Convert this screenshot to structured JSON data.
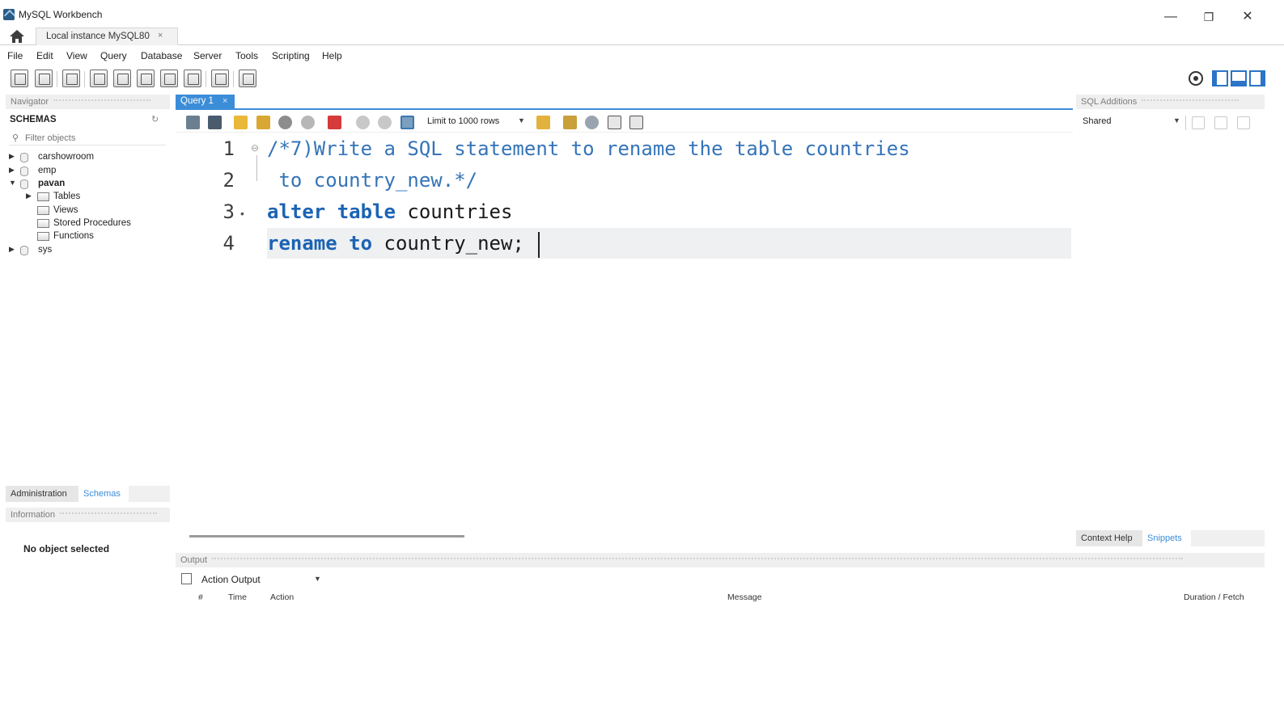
{
  "window": {
    "title": "MySQL Workbench",
    "minimize_glyph": "—",
    "restore_glyph": "❐",
    "close_glyph": "✕"
  },
  "connection_tab": {
    "label": "Local instance MySQL80",
    "close": "×"
  },
  "menu": [
    "File",
    "Edit",
    "View",
    "Query",
    "Database",
    "Server",
    "Tools",
    "Scripting",
    "Help"
  ],
  "navigator": {
    "header": "Navigator",
    "schemas_label": "SCHEMAS",
    "filter_placeholder": "Filter objects",
    "tree": [
      {
        "label": "carshowroom",
        "level": 0,
        "expanded": false,
        "type": "schema",
        "bold": false
      },
      {
        "label": "emp",
        "level": 0,
        "expanded": false,
        "type": "schema",
        "bold": false
      },
      {
        "label": "pavan",
        "level": 0,
        "expanded": true,
        "type": "schema",
        "bold": true
      },
      {
        "label": "Tables",
        "level": 1,
        "expanded": false,
        "type": "folder",
        "bold": false
      },
      {
        "label": "Views",
        "level": 1,
        "expanded": null,
        "type": "folder",
        "bold": false
      },
      {
        "label": "Stored Procedures",
        "level": 1,
        "expanded": null,
        "type": "folder",
        "bold": false
      },
      {
        "label": "Functions",
        "level": 1,
        "expanded": null,
        "type": "folder",
        "bold": false
      },
      {
        "label": "sys",
        "level": 0,
        "expanded": false,
        "type": "schema",
        "bold": false
      }
    ],
    "bottom_tabs": [
      "Administration",
      "Schemas"
    ],
    "active_bottom_tab": "Schemas",
    "info_header": "Information",
    "no_object": "No object selected"
  },
  "query_tab": {
    "label": "Query 1",
    "close": "×"
  },
  "sql_toolbar": {
    "limit_label": "Limit to 1000 rows"
  },
  "editor": {
    "lines": [
      {
        "num": "1",
        "marker": "",
        "segments": [
          {
            "text": "/*7)Write a SQL statement to rename the table countries",
            "cls": "cmt"
          }
        ]
      },
      {
        "num": "2",
        "marker": "",
        "segments": [
          {
            "text": " to country_new.*/",
            "cls": "cmt"
          }
        ]
      },
      {
        "num": "3",
        "marker": "•",
        "segments": [
          {
            "text": "alter table",
            "cls": "kw"
          },
          {
            "text": " countries",
            "cls": "id"
          }
        ]
      },
      {
        "num": "4",
        "marker": "",
        "segments": [
          {
            "text": "rename to",
            "cls": "kw"
          },
          {
            "text": " country_new;",
            "cls": "id"
          }
        ]
      }
    ]
  },
  "sql_additions": {
    "header": "SQL Additions",
    "shared_label": "Shared",
    "bottom_tabs": [
      "Context Help",
      "Snippets"
    ],
    "active_tab": "Snippets"
  },
  "output": {
    "header": "Output",
    "selector": "Action Output",
    "columns": [
      "#",
      "Time",
      "Action",
      "Message",
      "Duration / Fetch"
    ]
  },
  "colors": {
    "accent": "#3c8dd8",
    "keyword": "#1c63b4",
    "comment": "#3574b8",
    "active_link": "#3c8dd8"
  }
}
